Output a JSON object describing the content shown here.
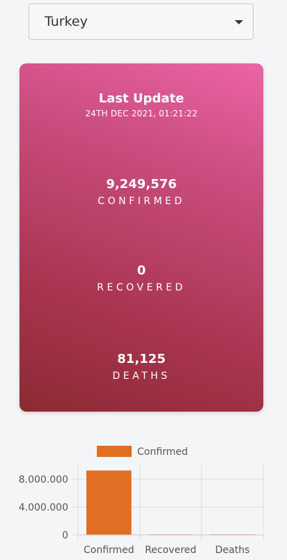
{
  "country_select": {
    "value": "Turkey"
  },
  "card": {
    "last_update_title": "Last Update",
    "last_update_time": "24TH DEC 2021, 01:21:22",
    "confirmed_value": "9,249,576",
    "confirmed_label": "CONFIRMED",
    "recovered_value": "0",
    "recovered_label": "RECOVERED",
    "deaths_value": "81,125",
    "deaths_label": "DEATHS"
  },
  "chart_data": {
    "type": "bar",
    "categories": [
      "Confirmed",
      "Recovered",
      "Deaths"
    ],
    "series": [
      {
        "name": "Confirmed",
        "values": [
          9249576,
          0,
          81125
        ]
      }
    ],
    "ylim": [
      0,
      10000000
    ],
    "yticks": [
      0,
      4000000,
      8000000
    ],
    "ytick_labels": [
      "0",
      "4.000.000",
      "8.000.000"
    ],
    "grid": true,
    "legend": "top",
    "bar_color": "#e06f24"
  }
}
